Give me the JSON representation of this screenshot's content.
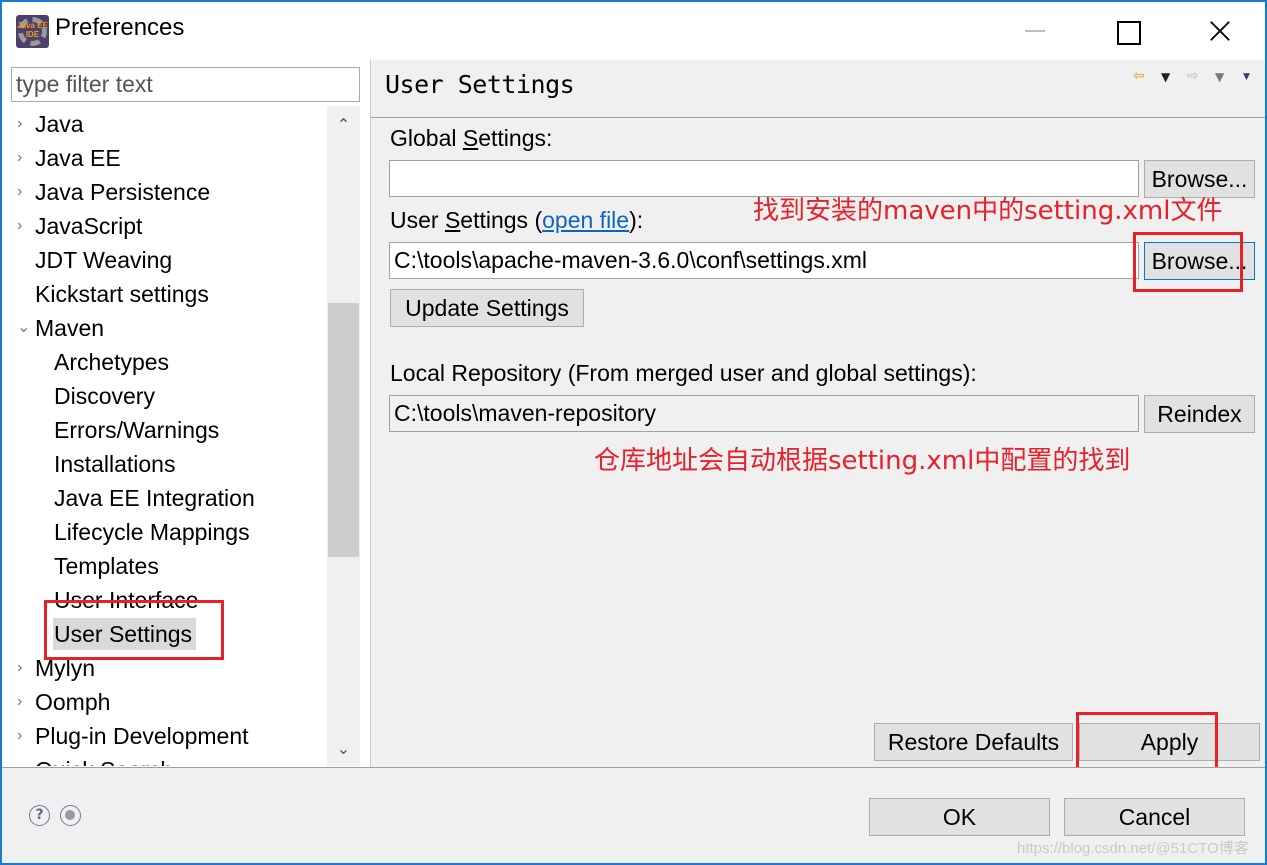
{
  "window": {
    "title": "Preferences",
    "app_icon_text": "Java EE IDE"
  },
  "filter": {
    "placeholder": "type filter text",
    "value": ""
  },
  "tree": {
    "items": [
      {
        "label": "Java",
        "expandable": true,
        "expanded": false,
        "level": 0
      },
      {
        "label": "Java EE",
        "expandable": true,
        "expanded": false,
        "level": 0
      },
      {
        "label": "Java Persistence",
        "expandable": true,
        "expanded": false,
        "level": 0
      },
      {
        "label": "JavaScript",
        "expandable": true,
        "expanded": false,
        "level": 0
      },
      {
        "label": "JDT Weaving",
        "expandable": false,
        "level": 0
      },
      {
        "label": "Kickstart settings",
        "expandable": false,
        "level": 0
      },
      {
        "label": "Maven",
        "expandable": true,
        "expanded": true,
        "level": 0
      },
      {
        "label": "Archetypes",
        "level": 1
      },
      {
        "label": "Discovery",
        "level": 1
      },
      {
        "label": "Errors/Warnings",
        "level": 1
      },
      {
        "label": "Installations",
        "level": 1
      },
      {
        "label": "Java EE Integration",
        "level": 1
      },
      {
        "label": "Lifecycle Mappings",
        "level": 1
      },
      {
        "label": "Templates",
        "level": 1
      },
      {
        "label": "User Interface",
        "level": 1
      },
      {
        "label": "User Settings",
        "level": 1,
        "selected": true
      },
      {
        "label": "Mylyn",
        "expandable": true,
        "expanded": false,
        "level": 0
      },
      {
        "label": "Oomph",
        "expandable": true,
        "expanded": false,
        "level": 0
      },
      {
        "label": "Plug-in Development",
        "expandable": true,
        "expanded": false,
        "level": 0
      },
      {
        "label": "Quick Search",
        "expandable": false,
        "level": 0
      }
    ],
    "chevron_collapsed": "›",
    "chevron_expanded": "⌄",
    "scroll_up": "⌃",
    "scroll_down": "⌄"
  },
  "page": {
    "title": "User Settings",
    "nav": {
      "back_icon": "⇦",
      "menu_icon": "▼",
      "forward_icon": "⇨",
      "view_menu_icon": "▼"
    },
    "global_settings": {
      "label_pre": "Global ",
      "label_mnemonic": "S",
      "label_post": "ettings:",
      "value": "",
      "browse_label": "Browse..."
    },
    "user_settings": {
      "label_pre": "User ",
      "label_mnemonic": "S",
      "label_post": "ettings (",
      "link": "open file",
      "label_end": "):",
      "value": "C:\\tools\\apache-maven-3.6.0\\conf\\settings.xml",
      "browse_label": "Browse..."
    },
    "update_settings_label": "Update Settings",
    "local_repository": {
      "label": "Local Repository (From merged user and global settings):",
      "value": "C:\\tools\\maven-repository",
      "reindex_label": "Reindex"
    },
    "annotations": {
      "find_settings": "找到安装的maven中的setting.xml文件",
      "repo_auto": "仓库地址会自动根据setting.xml中配置的找到"
    },
    "restore_defaults_label": "Restore Defaults",
    "apply_label": "Apply"
  },
  "bottom": {
    "help_icon": "?",
    "ok_label": "OK",
    "cancel_label": "Cancel"
  },
  "watermark": "https://blog.csdn.net/@51CTO博客",
  "colors": {
    "accent_border": "#1b7bd4",
    "annotation_red": "#e8202a",
    "link_blue": "#0b66c2",
    "selection_gray": "#d9d9d9"
  }
}
